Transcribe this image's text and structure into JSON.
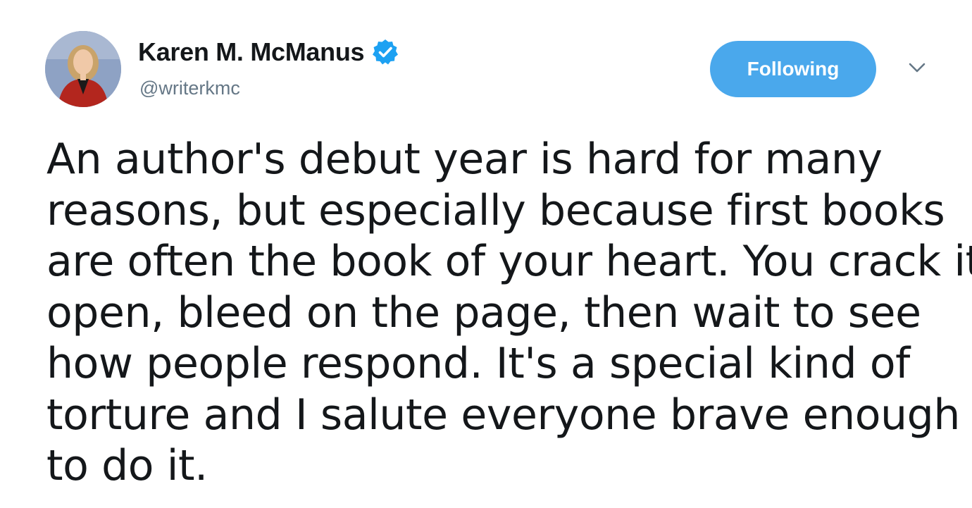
{
  "author": {
    "display_name": "Karen M. McManus",
    "handle": "@writerkmc",
    "verified": true,
    "avatar_icon": "profile-photo"
  },
  "actions": {
    "follow_label": "Following",
    "follow_color": "#4aa8ec",
    "more_icon": "chevron-down-icon"
  },
  "tweet": {
    "lines": [
      "An author's debut year is hard for many",
      "reasons, but especially because first books",
      "are often the book of your heart. You crack it",
      "open, bleed on the page, then wait to see",
      "how people respond. It's a special kind of",
      "torture and I salute everyone brave enough",
      "to do it."
    ]
  },
  "colors": {
    "text": "#14171a",
    "secondary": "#657786",
    "verified_badge": "#1da1f2"
  }
}
